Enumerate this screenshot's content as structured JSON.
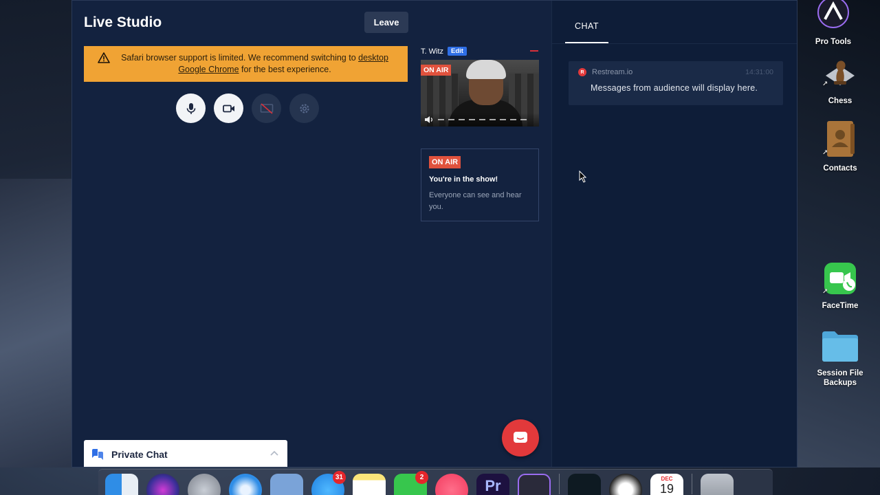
{
  "app": {
    "title": "Live Studio",
    "leave_label": "Leave"
  },
  "warning": {
    "text_before": "Safari browser support is limited. We recommend switching to ",
    "link_text": "desktop Google Chrome",
    "text_after": " for the best experience."
  },
  "controls": [
    {
      "name": "microphone-button",
      "icon": "mic-icon",
      "state": "on"
    },
    {
      "name": "camera-button",
      "icon": "video-camera-icon",
      "state": "on"
    },
    {
      "name": "screen-share-button",
      "icon": "screen-share-off-icon",
      "state": "off"
    },
    {
      "name": "settings-button",
      "icon": "gear-icon",
      "state": "off"
    }
  ],
  "participant": {
    "name": "T. Witz",
    "edit_label": "Edit",
    "on_air_label": "ON AIR"
  },
  "on_air_card": {
    "badge": "ON AIR",
    "title": "You're in the show!",
    "text": "Everyone can see and hear you."
  },
  "private_chat": {
    "label": "Private Chat"
  },
  "chat": {
    "tab_label": "CHAT",
    "message": {
      "source": "Restream.io",
      "source_initial": "R",
      "time": "14:31:00",
      "body": "Messages from audience will display here."
    }
  },
  "desktop_icons": [
    {
      "label": "Pro Tools",
      "icon": "pro-tools-icon"
    },
    {
      "label": "Chess",
      "icon": "chess-icon"
    },
    {
      "label": "Contacts",
      "icon": "contacts-icon"
    },
    {
      "label": "FaceTime",
      "icon": "facetime-icon"
    },
    {
      "label": "Session File Backups",
      "icon": "folder-icon"
    }
  ],
  "dock": {
    "mail_badge": "31",
    "messages_badge": "2",
    "premiere_label": "Pr",
    "calendar_month": "DEC",
    "calendar_day": "19"
  },
  "colors": {
    "studio_bg": "#13223f",
    "warning_bg": "#f0a334",
    "on_air_red": "#e0523d",
    "edit_blue": "#2f6fe6",
    "restream_red": "#e2393b"
  }
}
